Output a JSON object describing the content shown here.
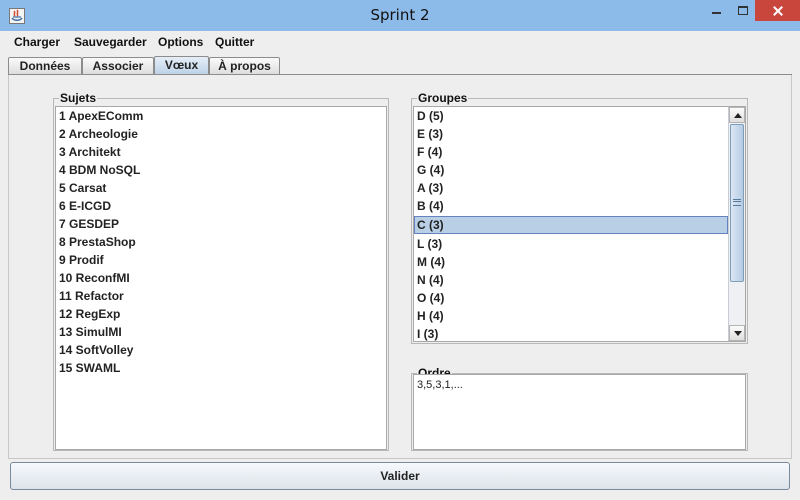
{
  "window": {
    "title": "Sprint 2"
  },
  "menu": [
    "Charger",
    "Sauvegarder",
    "Options",
    "Quitter"
  ],
  "tabs": [
    {
      "label": "Données",
      "active": false
    },
    {
      "label": "Associer",
      "active": false
    },
    {
      "label": "Vœux",
      "active": true
    },
    {
      "label": "À propos",
      "active": false
    }
  ],
  "sujets": {
    "title": "Sujets",
    "items": [
      "1 ApexEComm",
      "2 Archeologie",
      "3 Architekt",
      "4 BDM NoSQL",
      "5 Carsat",
      "6 E-ICGD",
      "7 GESDEP",
      "8 PrestaShop",
      "9 Prodif",
      "10 ReconfMI",
      "11 Refactor",
      "12 RegExp",
      "13 SimulMI",
      "14 SoftVolley",
      "15 SWAML"
    ]
  },
  "groupes": {
    "title": "Groupes",
    "items": [
      "D (5)",
      "E (3)",
      "F (4)",
      "G (4)",
      "A (3)",
      "B (4)",
      "C (3)",
      "L (3)",
      "M (4)",
      "N (4)",
      "O (4)",
      "H (4)",
      "I (3)"
    ],
    "selected_index": 6
  },
  "ordre": {
    "title": "Ordre",
    "value": "3,5,3,1,..."
  },
  "buttons": {
    "valider": "Valider"
  },
  "colors": {
    "titlebar": "#8dbbe9",
    "close": "#c9463d",
    "selection": "#b8cfe5"
  }
}
